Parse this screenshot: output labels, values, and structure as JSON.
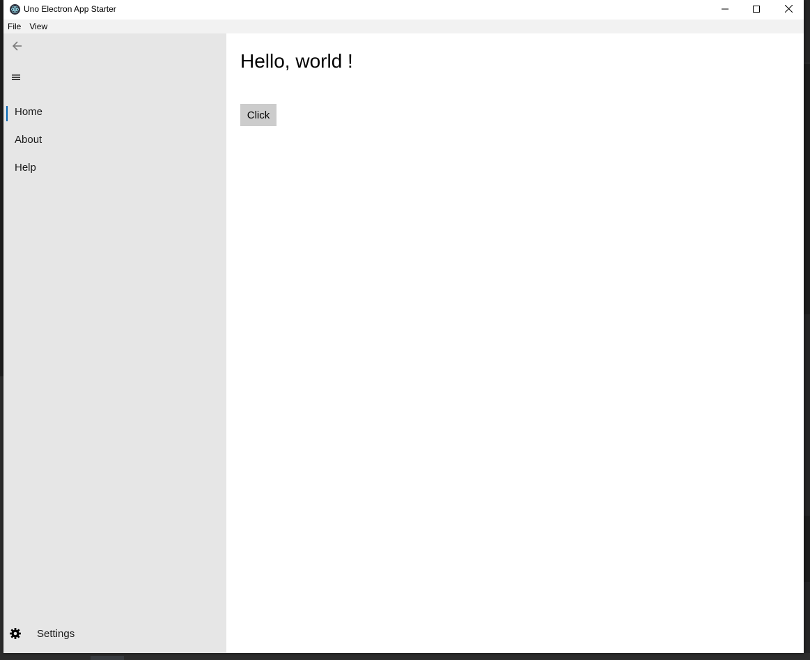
{
  "window": {
    "title": "Uno Electron App Starter"
  },
  "menubar": {
    "items": [
      "File",
      "View"
    ]
  },
  "sidebar": {
    "nav_items": [
      {
        "label": "Home",
        "selected": true
      },
      {
        "label": "About",
        "selected": false
      },
      {
        "label": "Help",
        "selected": false
      }
    ],
    "settings_label": "Settings"
  },
  "content": {
    "title": "Hello, world !",
    "button_label": "Click"
  },
  "icons": {
    "app": "electron-atom-icon",
    "back": "arrow-left-icon",
    "menu": "hamburger-icon",
    "settings": "gear-icon",
    "minimize": "minimize-icon",
    "maximize": "maximize-icon",
    "close": "close-icon"
  },
  "colors": {
    "accent": "#0063b1",
    "sidebar_bg": "#e6e6e6",
    "button_bg": "#cccccc",
    "menubar_bg": "#f2f2f2"
  }
}
